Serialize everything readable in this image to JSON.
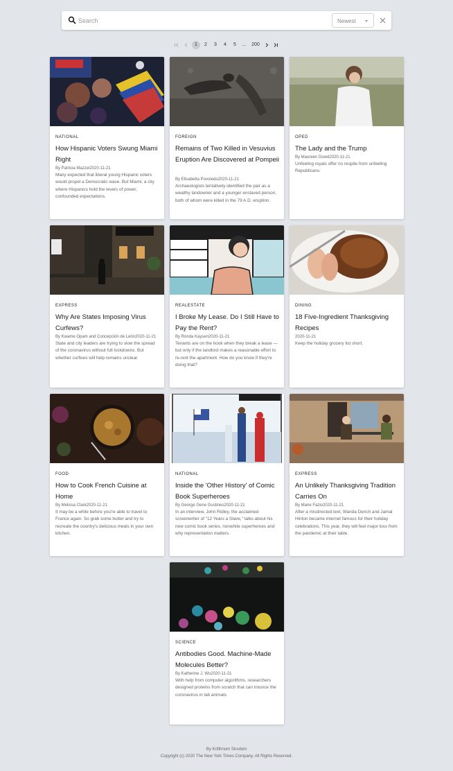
{
  "search": {
    "placeholder": "Search",
    "sort_value": "Newest"
  },
  "pagination": {
    "pages": [
      "1",
      "2",
      "3",
      "4",
      "5"
    ],
    "ellipsis": "...",
    "last_page": "200",
    "current": "1"
  },
  "articles": [
    {
      "section": "NATIONAL",
      "title": "How Hispanic Voters Swung Miami Right",
      "byline": "By Patricia Mazzei2020-11-21",
      "summary": "Many expected that liberal young Hispanic voters would propel a Democratic wave. But Miami, a city where Hispanics hold the levers of power, confounded expectations."
    },
    {
      "section": "FOREIGN",
      "title": "Remains of Two Killed in Vesuvius Eruption Are Discovered at Pompeii",
      "byline": "By Elisabetta Povoledo2020-11-21",
      "summary": "Archaeologists tentatively identified the pair as a wealthy landowner and a younger enslaved person, both of whom were killed in the 79 A.D. eruption."
    },
    {
      "section": "OPED",
      "title": "The Lady and the Trump",
      "byline": "By Maureen Dowd2020-11-21",
      "summary": "Unfeeling royals offer no respite from unfeeling Republicans."
    },
    {
      "section": "EXPRESS",
      "title": "Why Are States Imposing Virus Curfews?",
      "byline": "By Kwame Opam and Concepción de León2020-11-21",
      "summary": "State and city leaders are trying to slow the spread of the coronavirus without full lockdowns. But whether curfews will help remains unclear."
    },
    {
      "section": "REALESTATE",
      "title": "I Broke My Lease. Do I Still Have to Pay the Rent?",
      "byline": "By Ronda Kaysen2020-11-21",
      "summary": "Tenants are on the hook when they break a lease — but only if the landlord makes a reasonable effort to re-rent the apartment. How do you know if they're doing that?"
    },
    {
      "section": "DINING",
      "title": "18 Five-Ingredient Thanksgiving Recipes",
      "byline": "2020-11-21",
      "summary": "Keep the holiday grocery list short."
    },
    {
      "section": "FOOD",
      "title": "How to Cook French Cuisine at Home",
      "byline": "By Melissa Clark2020-11-21",
      "summary": "It may be a while before you're able to travel to France again. So grab some butter and try to recreate the country's delicious meals in your own kitchen."
    },
    {
      "section": "NATIONAL",
      "title": "Inside the 'Other History' of Comic Book Superheroes",
      "byline": "By George Gene Gustines2020-11-21",
      "summary": "In an interview, John Ridley, the acclaimed screenwriter of \"12 Years a Slave,\" talks about his new comic book series, nonwhite superheroes and why representation matters."
    },
    {
      "section": "EXPRESS",
      "title": "An Unlikely Thanksgiving Tradition Carries On",
      "byline": "By Marie Fazio2020-11-21",
      "summary": "After a misdirected text, Wanda Dench and Jamal Hinton became internet famous for their holiday celebrations. This year, they will feel major loss from the pandemic at their table."
    },
    {
      "section": "SCIENCE",
      "title": "Antibodies Good. Machine-Made Molecules Better?",
      "byline": "By Katherine J. Wu2020-11-21",
      "summary": "With help from computer algorithms, researchers designed proteins from scratch that can trounce the coronavirus in lab animals."
    }
  ],
  "footer": {
    "author": "By Kritthnum Sirodom",
    "copyright": "Copyright (c) 2020 The New York Times Company. All Rights Reserved."
  }
}
